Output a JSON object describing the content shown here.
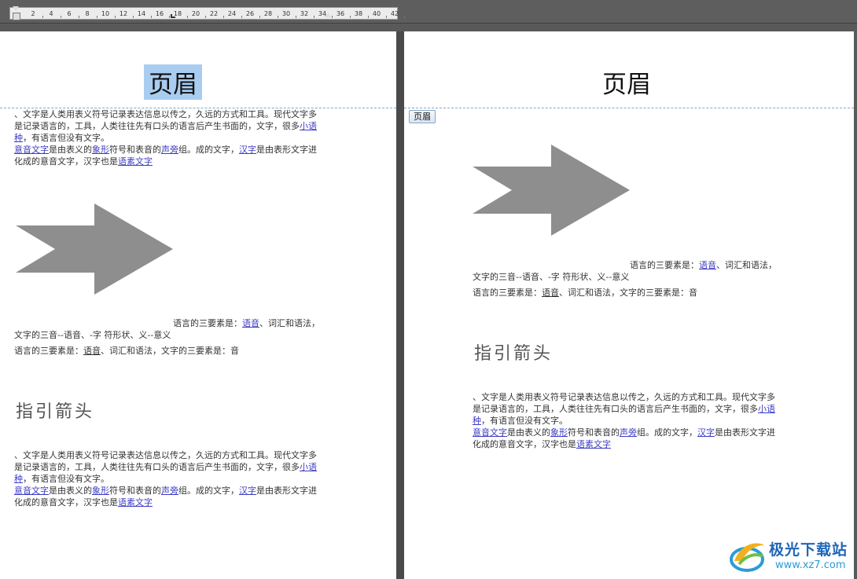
{
  "ruler": {
    "ticks": [
      "2",
      "4",
      "6",
      "8",
      "10",
      "12",
      "14",
      "16",
      "18",
      "20",
      "22",
      "24",
      "26",
      "28",
      "30",
      "32",
      "34",
      "36",
      "38",
      "40",
      "42"
    ]
  },
  "header": {
    "title": "页眉",
    "tag_label": "页眉"
  },
  "text_block": {
    "line1": "、文字是人类用表义符号记录表达信息以传之，久远的方式和工具。现代文字多",
    "line2_a": "是记录语言的，工具，人类往往先有口头的语言后产生书面的，文字，很多",
    "line2_link": "小语",
    "line3_link": "种",
    "line3_b": "，有语言但没有文字。",
    "line4_link1": "意音文字",
    "line4_a": "是由表义的",
    "line4_link2": "象形",
    "line4_b": "符号和表音的",
    "line4_link3": "声旁",
    "line4_c": "组。成的文字，",
    "line4_link4": "汉字",
    "line4_d": "是由表形文字进",
    "line5_a": "化成的意音文字，汉字也是",
    "line5_link": "语素文字"
  },
  "elements_block": {
    "l1_a": "语言的三要素是：",
    "l1_link": "语音",
    "l1_b": "、词汇和语法，",
    "l2": "文字的三音--语音、-字 符形状、义--意义",
    "l3_a": "语言的三要素是：",
    "l3_ul": "语音",
    "l3_b": "、词汇和语法，文字的三要素是：音"
  },
  "heading": "指引箭头",
  "colors": {
    "arrow_fill": "#8e8e8e",
    "selection": "#a9cdf0",
    "link": "#3c3cc4"
  },
  "watermark": {
    "title": "极光下载站",
    "url": "www.xz7.com"
  }
}
